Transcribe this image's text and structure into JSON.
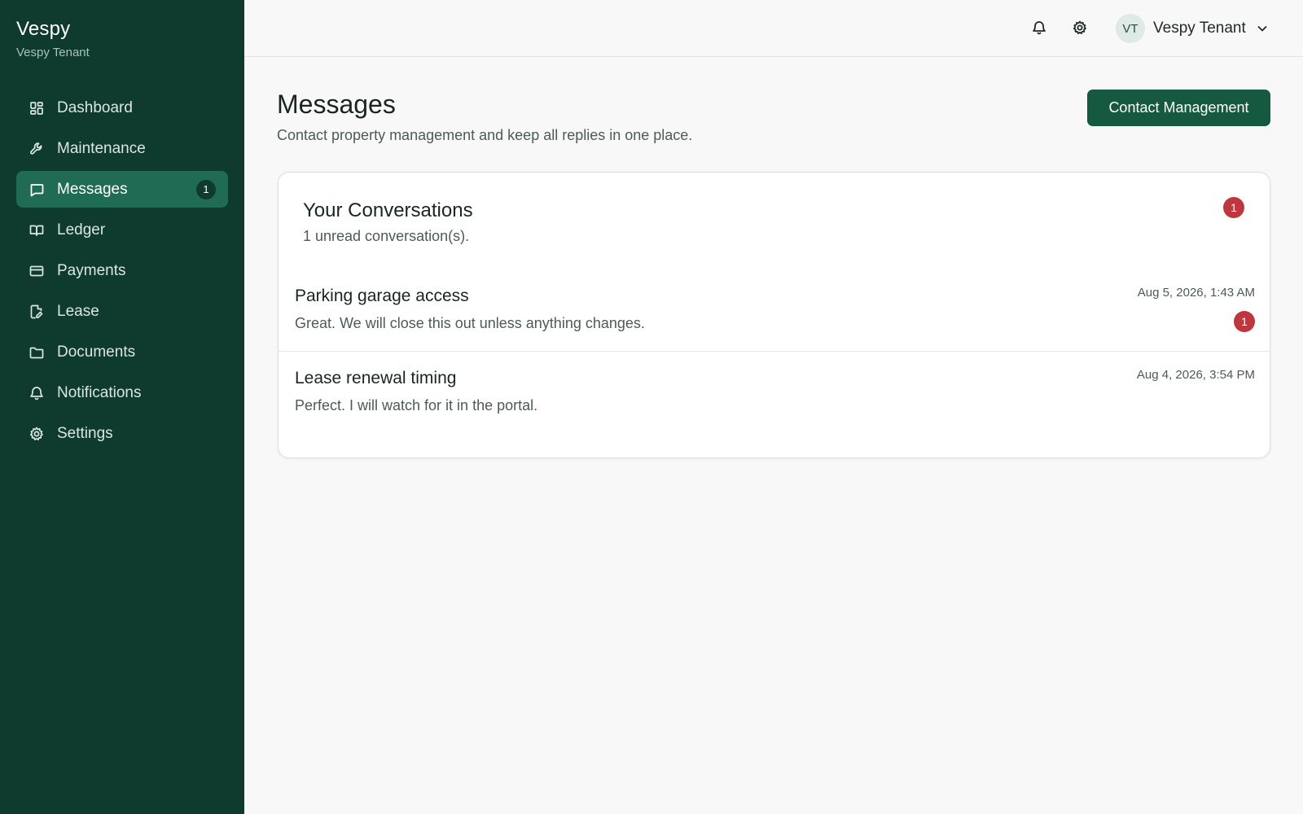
{
  "brand": {
    "name": "Vespy",
    "subtitle": "Vespy Tenant"
  },
  "sidebar": {
    "items": [
      {
        "label": "Dashboard",
        "icon": "dashboard-icon",
        "active": false
      },
      {
        "label": "Maintenance",
        "icon": "wrench-icon",
        "active": false
      },
      {
        "label": "Messages",
        "icon": "message-icon",
        "active": true,
        "badge": "1"
      },
      {
        "label": "Ledger",
        "icon": "book-icon",
        "active": false
      },
      {
        "label": "Payments",
        "icon": "credit-card-icon",
        "active": false
      },
      {
        "label": "Lease",
        "icon": "file-edit-icon",
        "active": false
      },
      {
        "label": "Documents",
        "icon": "folder-icon",
        "active": false
      },
      {
        "label": "Notifications",
        "icon": "bell-icon",
        "active": false
      },
      {
        "label": "Settings",
        "icon": "gear-icon",
        "active": false
      }
    ]
  },
  "topbar": {
    "user_initials": "VT",
    "user_name": "Vespy Tenant"
  },
  "page": {
    "title": "Messages",
    "subtitle": "Contact property management and keep all replies in one place.",
    "primary_button": "Contact Management"
  },
  "conversations_card": {
    "title": "Your Conversations",
    "subtitle": "1 unread conversation(s).",
    "unread_badge": "1",
    "items": [
      {
        "title": "Parking garage access",
        "preview": "Great. We will close this out unless anything changes.",
        "time": "Aug 5, 2026, 1:43 AM",
        "unread": "1"
      },
      {
        "title": "Lease renewal timing",
        "preview": "Perfect. I will watch for it in the portal.",
        "time": "Aug 4, 2026, 3:54 PM"
      }
    ]
  },
  "colors": {
    "sidebar_bg": "#0f3b2e",
    "active_nav": "#1f6b53",
    "primary": "#155940",
    "unread_badge": "#c0363f"
  }
}
